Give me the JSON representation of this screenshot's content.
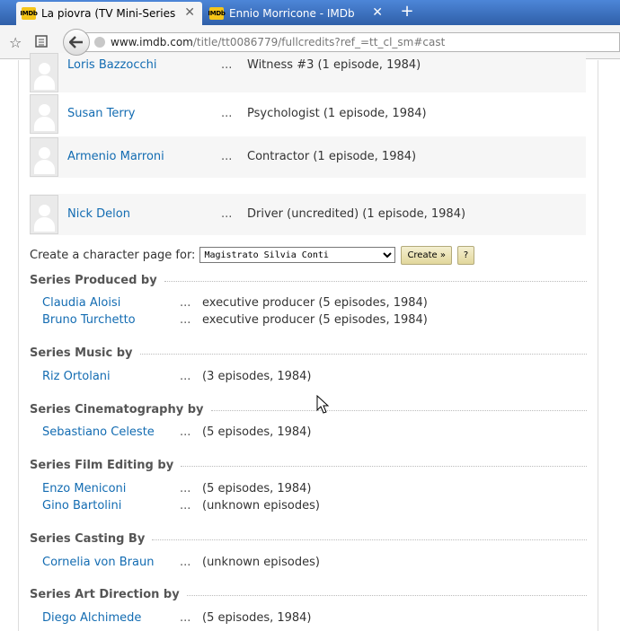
{
  "browser": {
    "tabs": [
      {
        "favicon": "IMDb",
        "title": "La piovra (TV Mini-Series ...",
        "active": true
      },
      {
        "favicon": "IMDb",
        "title": "Ennio Morricone - IMDb",
        "active": false
      }
    ],
    "close_glyph": "✕",
    "new_tab_glyph": "+",
    "url_host": "www.imdb.com",
    "url_path": "/title/tt0086779/fullcredits?ref_=tt_cl_sm#cast"
  },
  "cast": [
    {
      "name": "Loris Bazzocchi",
      "dots": "...",
      "character": "Witness #3 (1 episode, 1984)"
    },
    {
      "name": "Susan Terry",
      "dots": "...",
      "character": "Psychologist (1 episode, 1984)"
    },
    {
      "name": "Armenio Marroni",
      "dots": "...",
      "character": "Contractor (1 episode, 1984)"
    },
    {
      "name": "Nick Delon",
      "dots": "...",
      "character": "Driver (uncredited) (1 episode, 1984)"
    }
  ],
  "character_page": {
    "label": "Create a character page for:",
    "selected": "Magistrato Silvia Conti",
    "create_label": "Create »",
    "help_label": "?"
  },
  "sections": [
    {
      "title": "Series Produced by",
      "rows": [
        {
          "name": "Claudia Aloisi",
          "dots": "...",
          "credit": "executive producer (5 episodes, 1984)"
        },
        {
          "name": "Bruno Turchetto",
          "dots": "...",
          "credit": "executive producer (5 episodes, 1984)"
        }
      ]
    },
    {
      "title": "Series Music by",
      "rows": [
        {
          "name": "Riz Ortolani",
          "dots": "...",
          "credit": "(3 episodes, 1984)"
        }
      ]
    },
    {
      "title": "Series Cinematography by",
      "rows": [
        {
          "name": "Sebastiano Celeste",
          "dots": "...",
          "credit": "(5 episodes, 1984)"
        }
      ]
    },
    {
      "title": "Series Film Editing by",
      "rows": [
        {
          "name": "Enzo Meniconi",
          "dots": "...",
          "credit": "(5 episodes, 1984)"
        },
        {
          "name": "Gino Bartolini",
          "dots": "...",
          "credit": "(unknown episodes)"
        }
      ]
    },
    {
      "title": "Series Casting By",
      "rows": [
        {
          "name": "Cornelia von Braun",
          "dots": "...",
          "credit": "(unknown episodes)"
        }
      ]
    },
    {
      "title": "Series Art Direction by",
      "rows": [
        {
          "name": "Diego Alchimede",
          "dots": "...",
          "credit": "(5 episodes, 1984)"
        }
      ]
    }
  ]
}
